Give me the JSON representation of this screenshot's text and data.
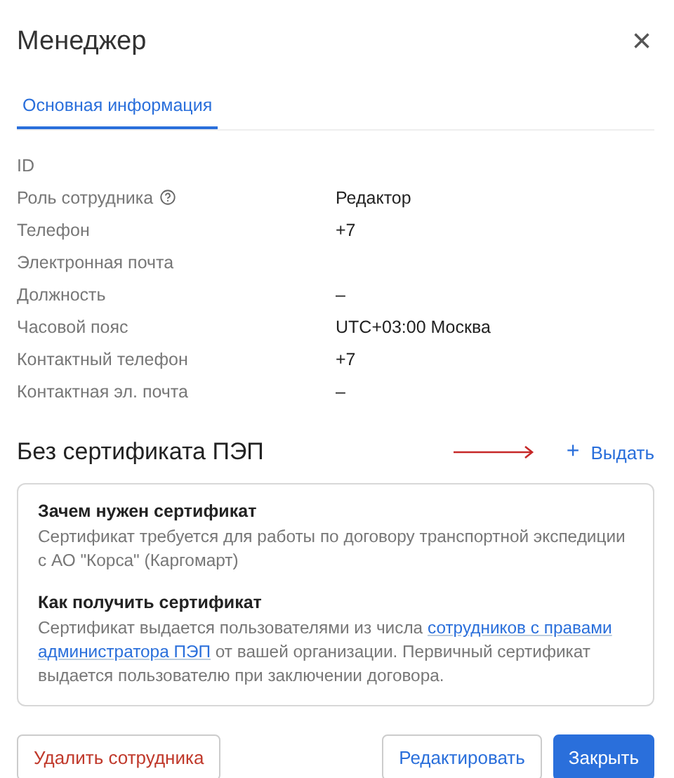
{
  "dialog": {
    "title": "Менеджер",
    "close_icon": "×"
  },
  "tabs": [
    {
      "label": "Основная информация",
      "selected": true
    }
  ],
  "fields": [
    {
      "label": "ID"
    },
    {
      "label": "Роль сотрудника",
      "help": true,
      "value": "Редактор"
    },
    {
      "label": "Телефон",
      "value": "+7"
    },
    {
      "label": "Электронная почта"
    },
    {
      "label": "Должность",
      "value": "–"
    },
    {
      "label": "Часовой пояс",
      "value": "UTC+03:00 Москва"
    },
    {
      "label": "Контактный телефон",
      "value": "+7"
    },
    {
      "label": "Контактная эл. почта",
      "value": "–"
    }
  ],
  "certificate": {
    "title": "Без сертификата ПЭП",
    "action": {
      "icon": "+",
      "label": "Выдать"
    },
    "info": [
      {
        "heading": "Зачем нужен сертификат",
        "text": "Сертификат требуется для работы по договору транспортной экспедиции с АО \"Корса\" (Каргомарт)"
      },
      {
        "heading": "Как получить сертификат",
        "text": "Сертификат выдается пользователями из числа ",
        "link": [
          "сотрудников с правами",
          "администратора ПЭП"
        ],
        "text_after": " от вашей организации. Первичный сертификат выдается пользователю при заключении договора."
      }
    ]
  },
  "buttons": [
    {
      "label": "Удалить сотрудника",
      "kind": "danger"
    },
    {
      "label": "Редактировать",
      "kind": "secondary"
    },
    {
      "label": "Закрыть",
      "kind": "primary"
    }
  ]
}
